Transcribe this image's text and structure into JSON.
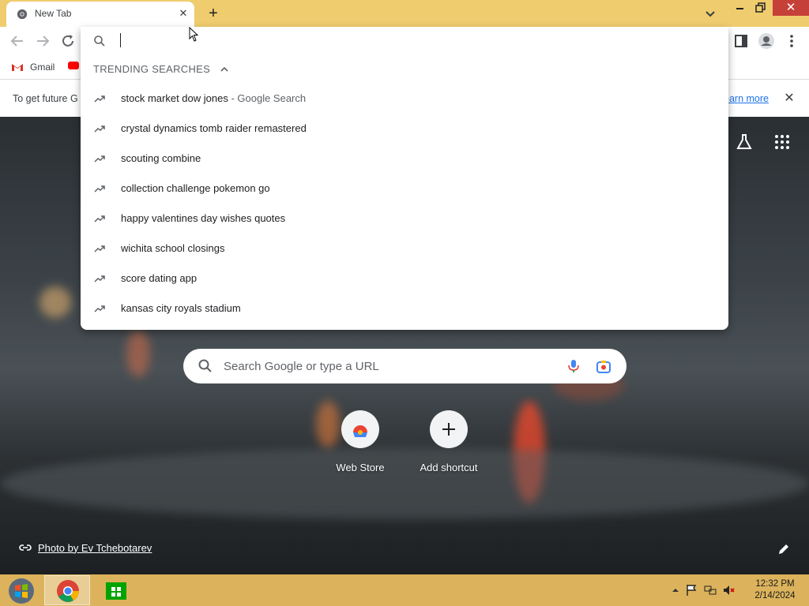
{
  "tab": {
    "title": "New Tab",
    "close": "✕"
  },
  "tabstrip": {
    "new_tab": "+",
    "close_window": "✕"
  },
  "bookmarks": {
    "gmail": "Gmail"
  },
  "infobar": {
    "text": "To get future G",
    "link": "earn more",
    "close": "✕"
  },
  "omnibox": {
    "value": "",
    "trending_header": "TRENDING SEARCHES",
    "suggestions": [
      {
        "text": "stock market dow jones",
        "suffix": " - Google Search"
      },
      {
        "text": "crystal dynamics tomb raider remastered",
        "suffix": ""
      },
      {
        "text": "scouting combine",
        "suffix": ""
      },
      {
        "text": "collection challenge pokemon go",
        "suffix": ""
      },
      {
        "text": "happy valentines day wishes quotes",
        "suffix": ""
      },
      {
        "text": "wichita school closings",
        "suffix": ""
      },
      {
        "text": "score dating app",
        "suffix": ""
      },
      {
        "text": "kansas city royals stadium",
        "suffix": ""
      }
    ]
  },
  "ntp": {
    "search_placeholder": "Search Google or type a URL",
    "shortcuts": [
      {
        "label": "Web Store",
        "icon": "webstore-icon"
      },
      {
        "label": "Add shortcut",
        "icon": "plus-icon"
      }
    ],
    "photo_credit": "Photo by Ev Tchebotarev"
  },
  "taskbar": {
    "time": "12:32 PM",
    "date": "2/14/2024"
  },
  "colors": {
    "tabstrip": "#efcc6e",
    "taskbar": "#dcb35c",
    "close": "#c6403a",
    "link": "#1a73e8"
  }
}
